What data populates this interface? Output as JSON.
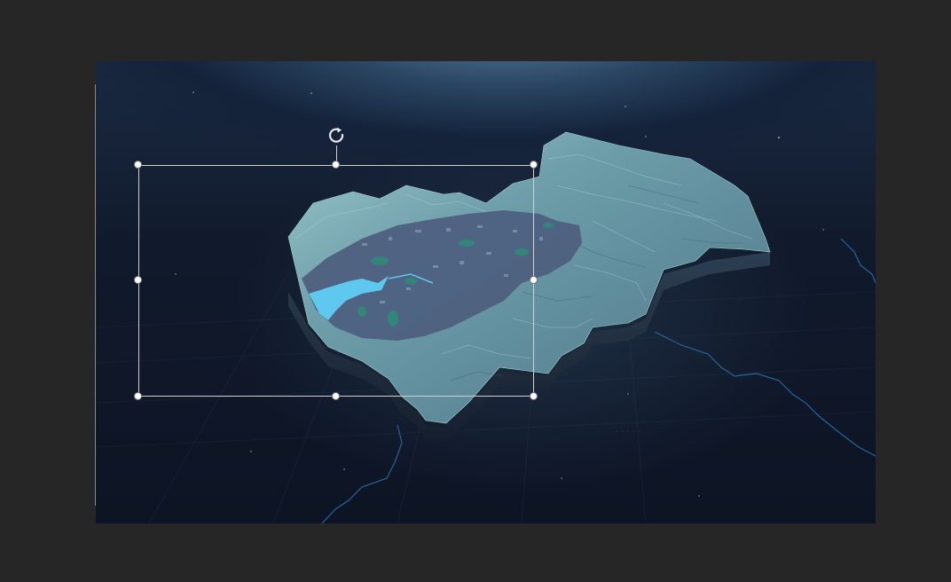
{
  "canvas": {
    "background_color": "#262626",
    "slide_background": "#111a2c"
  },
  "slide": {
    "content": "3d-terrain-map",
    "map_colors": {
      "terrain": "#5e8a98",
      "terrain_highlight": "#a8d2d8",
      "urban": "#4a5d80",
      "water": "#5ec8ee",
      "green": "#2e8c78",
      "boundary_line": "#2a6da8"
    },
    "watermark_text": "· · · · ·"
  },
  "selection": {
    "state": "selected",
    "handles": [
      "top-left",
      "top-middle",
      "top-right",
      "middle-left",
      "middle-right",
      "bottom-left",
      "bottom-middle",
      "bottom-right"
    ],
    "rotate_icon": "rotate-icon"
  }
}
